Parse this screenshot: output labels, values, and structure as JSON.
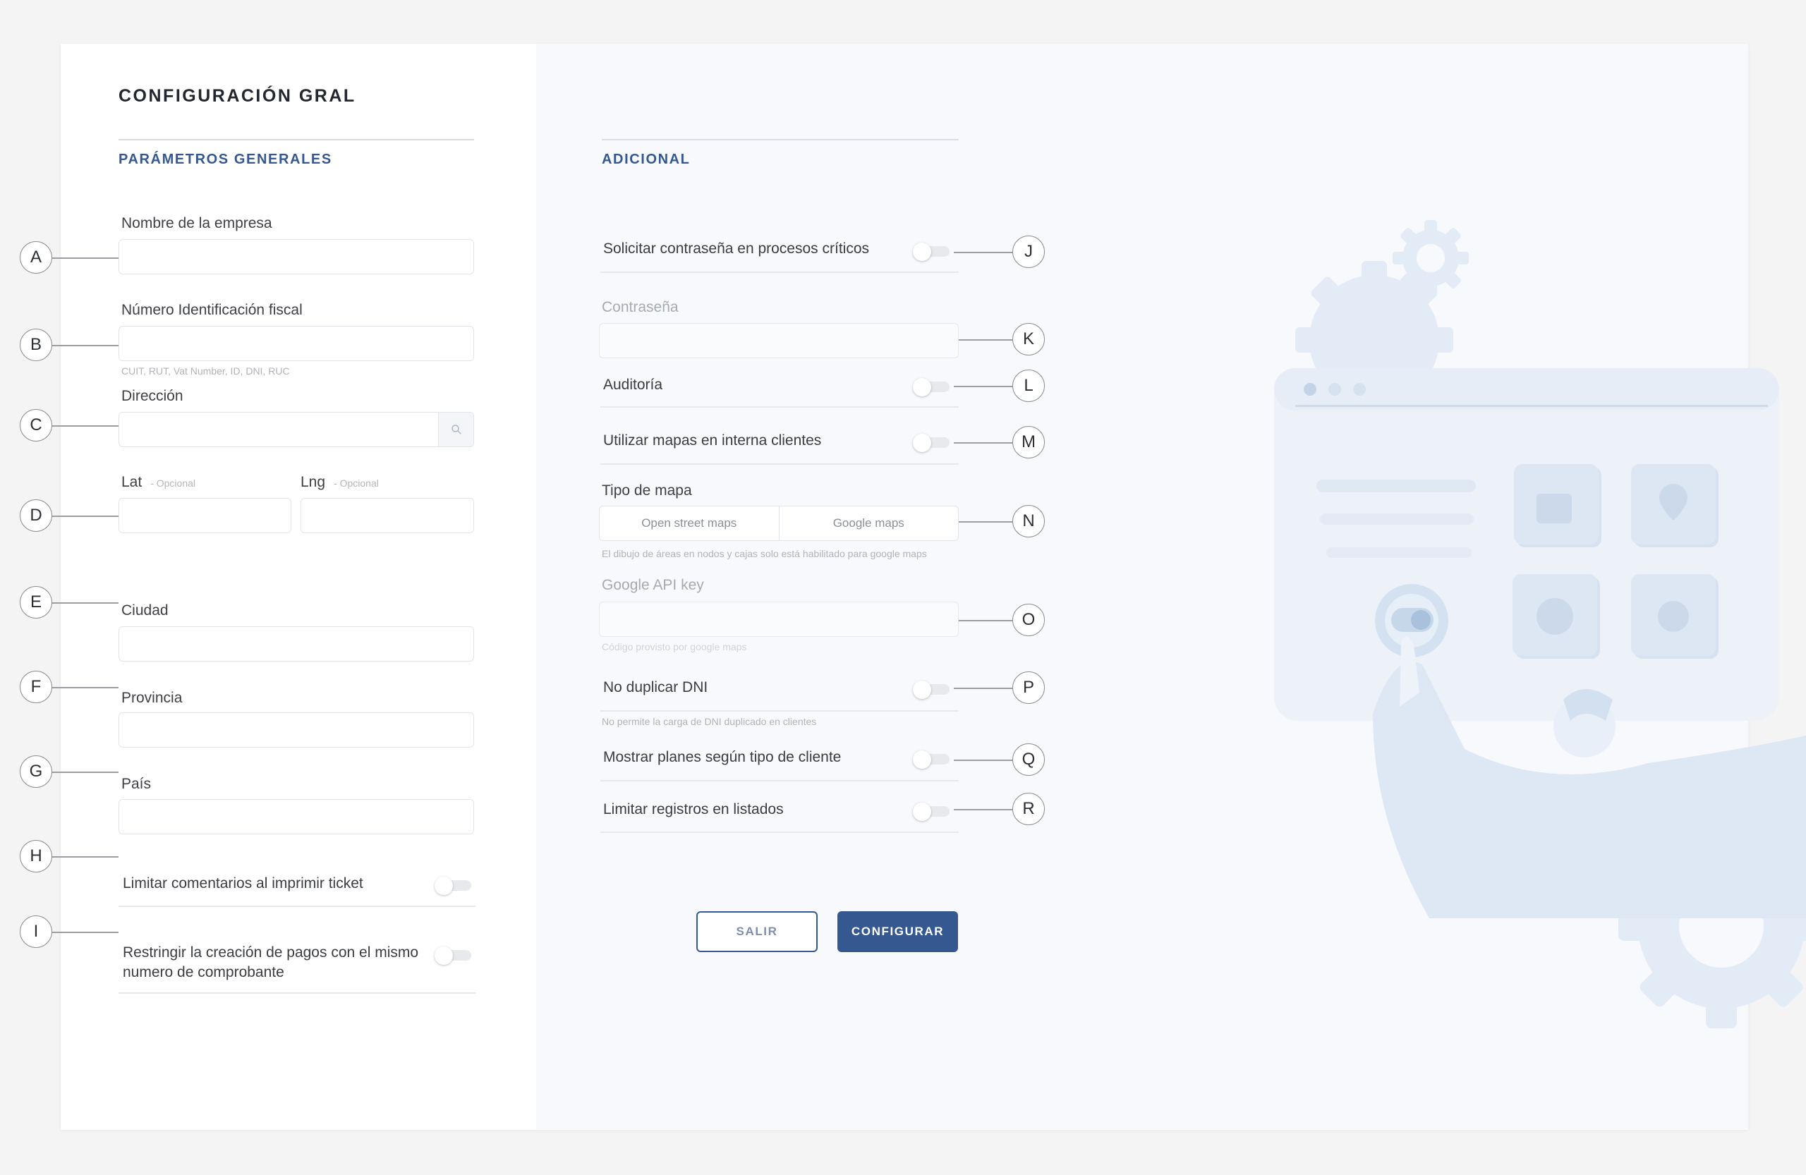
{
  "page": {
    "title": "CONFIGURACIÓN GRAL"
  },
  "colors": {
    "accent": "#34588f",
    "panel_bg": "#f7f9fc",
    "illustration": "#dfe9f5"
  },
  "general": {
    "section_title": "PARÁMETROS GENERALES",
    "company_name": {
      "label": "Nombre de la empresa",
      "value": ""
    },
    "tax_id": {
      "label": "Número Identificación fiscal",
      "value": "",
      "help": "CUIT, RUT, Vat Number, ID, DNI, RUC"
    },
    "address": {
      "label": "Dirección",
      "value": "",
      "icon": "search-icon"
    },
    "lat": {
      "label": "Lat",
      "optional": "- Opcional",
      "value": ""
    },
    "lng": {
      "label": "Lng",
      "optional": "- Opcional",
      "value": ""
    },
    "city": {
      "label": "Ciudad",
      "value": ""
    },
    "province": {
      "label": "Provincia",
      "value": ""
    },
    "country": {
      "label": "País",
      "value": ""
    },
    "limit_comments": {
      "label": "Limitar comentarios al imprimir ticket",
      "enabled": false
    },
    "restrict_payments": {
      "label_line1": "Restringir la creación de pagos con el mismo",
      "label_line2": "numero de comprobante",
      "enabled": false
    }
  },
  "additional": {
    "section_title": "ADICIONAL",
    "request_password": {
      "label": "Solicitar contraseña en procesos críticos",
      "enabled": false
    },
    "password": {
      "label": "Contraseña",
      "value": ""
    },
    "audit": {
      "label": "Auditoría",
      "enabled": false
    },
    "use_maps": {
      "label": "Utilizar mapas en interna clientes",
      "enabled": false
    },
    "map_type": {
      "label": "Tipo de mapa",
      "options": [
        "Open street maps",
        "Google maps"
      ],
      "help": "El dibujo de áreas en nodos y cajas solo está habilitado para google maps"
    },
    "google_api_key": {
      "label": "Google API key",
      "value": "",
      "help": "Código provisto por google maps"
    },
    "no_duplicate_dni": {
      "label": "No duplicar DNI",
      "enabled": false,
      "help": "No permite la carga de DNI duplicado en clientes"
    },
    "show_plans": {
      "label": "Mostrar planes según tipo de cliente",
      "enabled": false
    },
    "limit_records": {
      "label": "Limitar registros en listados",
      "enabled": false
    }
  },
  "buttons": {
    "exit": "SALIR",
    "configure": "CONFIGURAR"
  },
  "callouts": {
    "A": "A",
    "B": "B",
    "C": "C",
    "D": "D",
    "E": "E",
    "F": "F",
    "G": "G",
    "H": "H",
    "I": "I",
    "J": "J",
    "K": "K",
    "L": "L",
    "M": "M",
    "N": "N",
    "O": "O",
    "P": "P",
    "Q": "Q",
    "R": "R"
  }
}
